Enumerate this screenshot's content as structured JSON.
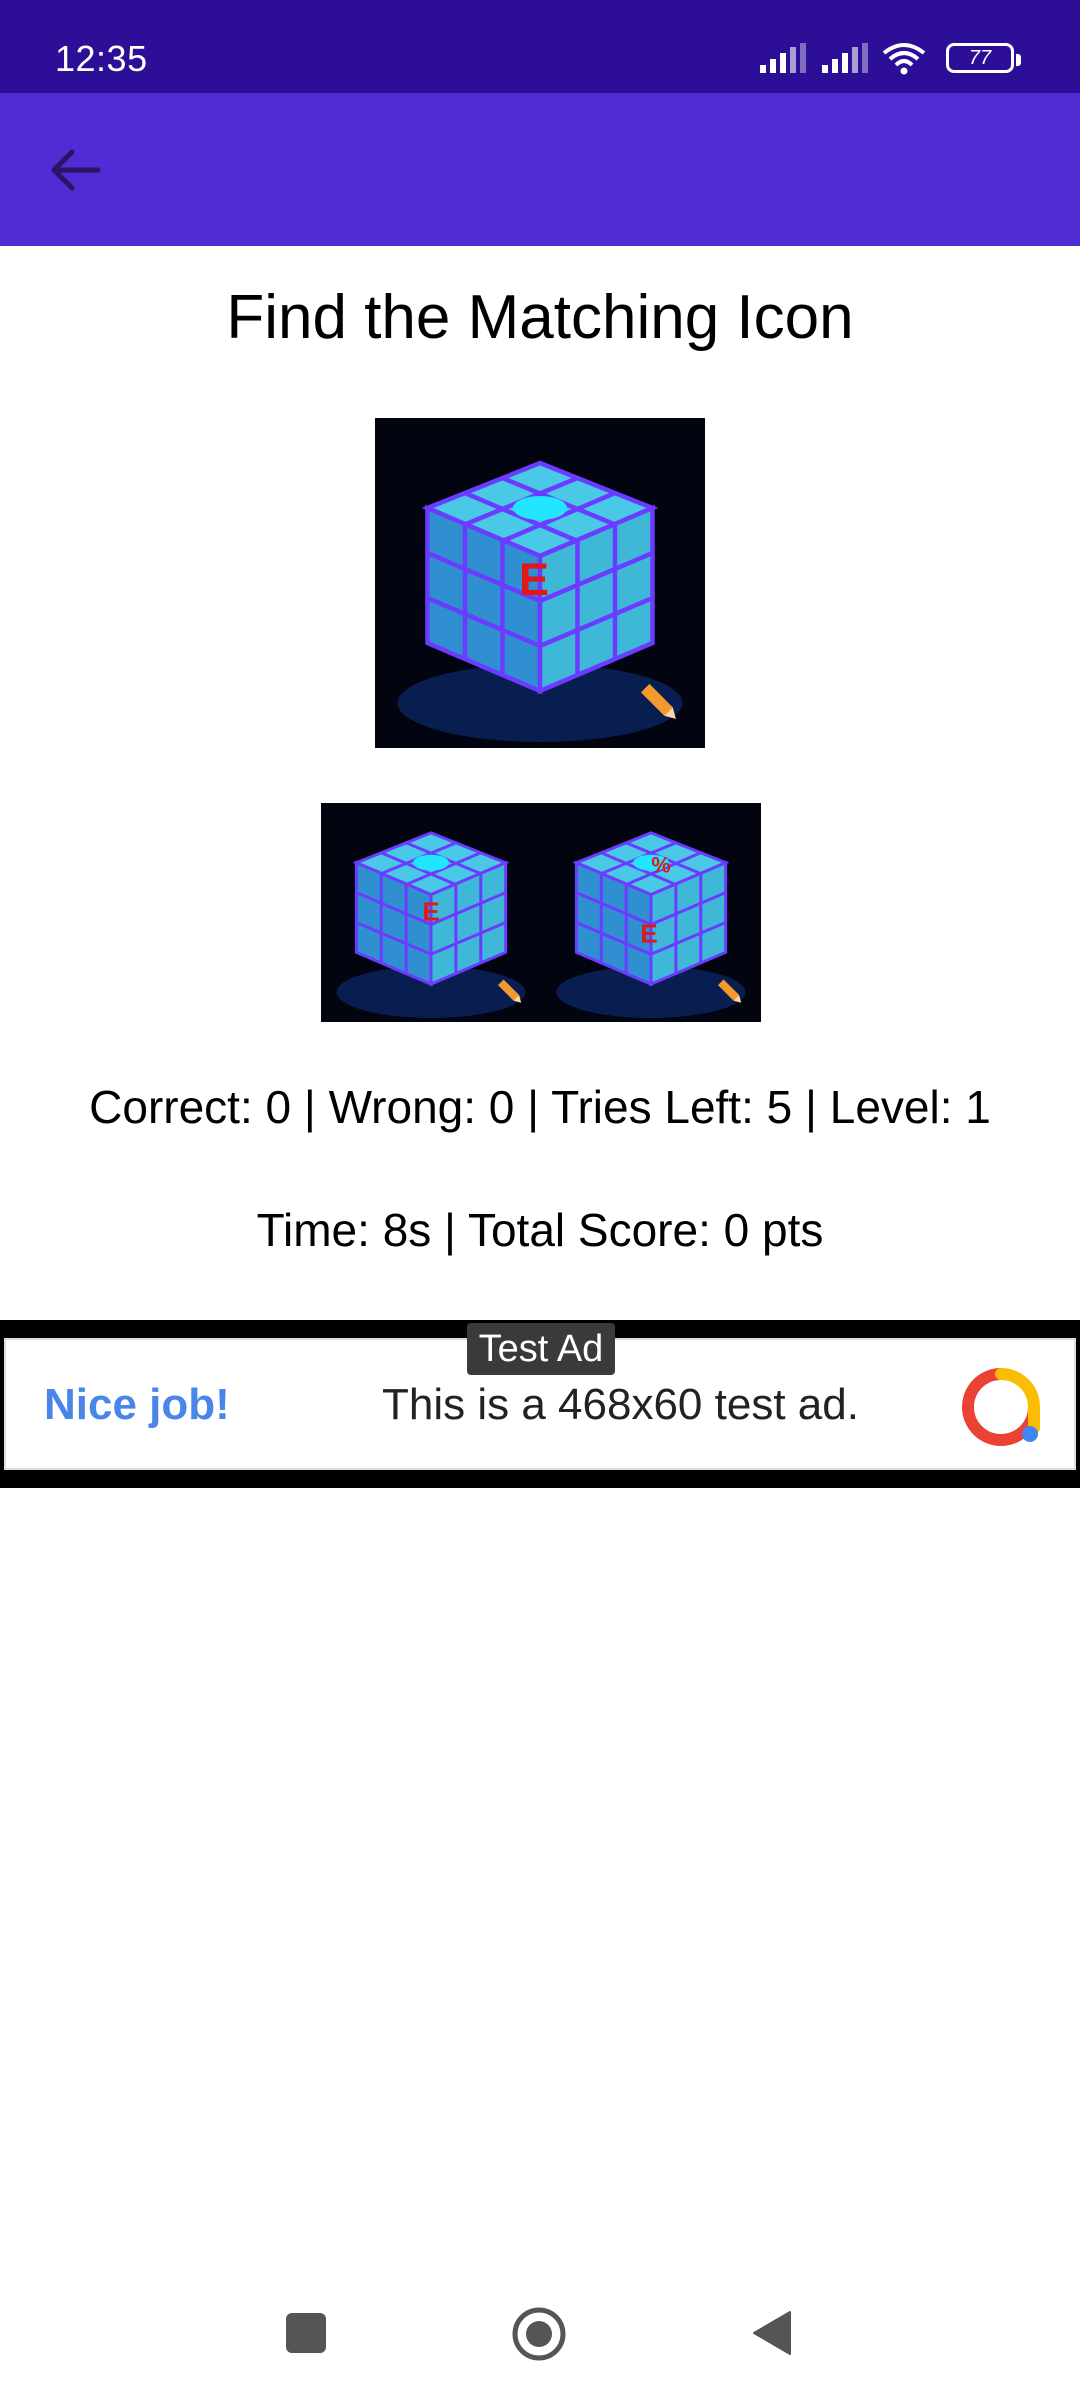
{
  "status_bar": {
    "time": "12:35",
    "battery_level": "77"
  },
  "app_bar": {
    "back_icon": "arrow-left-icon"
  },
  "game": {
    "title": "Find the Matching Icon",
    "target": {
      "overlay_letter": "E"
    },
    "choices": [
      {
        "overlay_letters": [
          "E"
        ]
      },
      {
        "overlay_letters": [
          "%",
          "E"
        ]
      }
    ],
    "stats": "Correct: 0 | Wrong: 0 | Tries Left: 5 | Level: 1",
    "time_score": "Time: 8s | Total Score: 0 pts"
  },
  "ad": {
    "label": "Test Ad",
    "headline": "Nice job!",
    "body": "This is a 468x60 test ad."
  },
  "colors": {
    "status_bar": "#2c0f96",
    "app_bar": "#512bd4",
    "cube_face": "#3fb8d8",
    "overlay_red": "#e01818"
  }
}
